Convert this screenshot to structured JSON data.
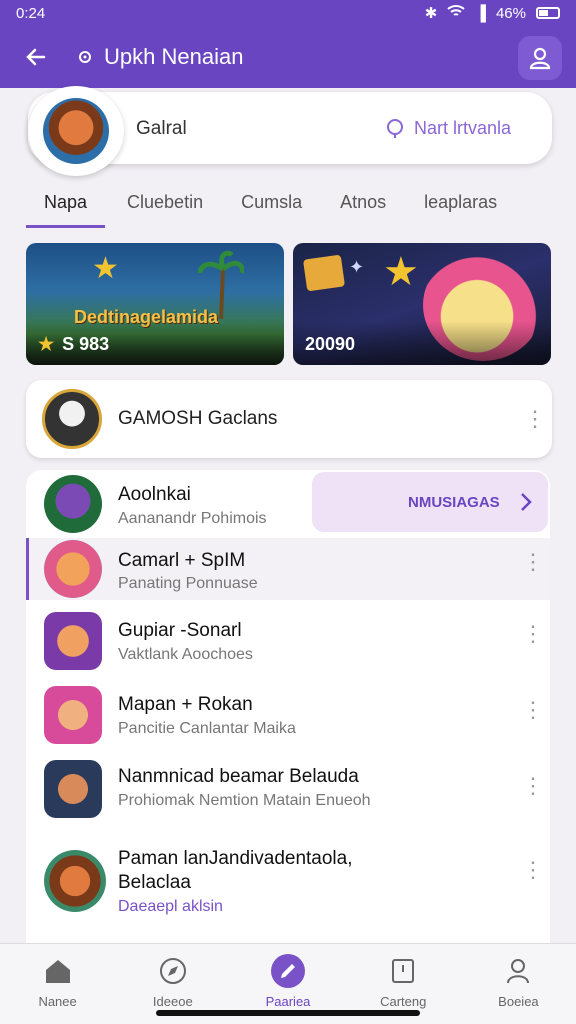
{
  "status_bar": {
    "time": "0:24",
    "battery": "46%"
  },
  "app_bar": {
    "title": "Upkh Nenaian"
  },
  "header_card": {
    "name": "Galral",
    "link_label": "Nart lrtvanla"
  },
  "tabs": [
    {
      "label": "Napa",
      "active": true
    },
    {
      "label": "Cluebetin",
      "active": false
    },
    {
      "label": "Cumsla",
      "active": false
    },
    {
      "label": "Atnos",
      "active": false
    },
    {
      "label": "leaplaras",
      "active": false
    }
  ],
  "banners": [
    {
      "title": "Dedtinagelamida",
      "price": "S 983"
    },
    {
      "title": "",
      "price": "20090"
    }
  ],
  "featured": {
    "name": "GAMOSH Gaclans"
  },
  "list": [
    {
      "name": "Aoolnkai",
      "sub": "Aananandr Pohimois",
      "cta": "NMUSIAGAS"
    },
    {
      "name": "Camarl + SpIM",
      "sub": "Panating Ponnuase",
      "selected": true
    },
    {
      "name": "Gupiar -Sonarl",
      "sub": "Vaktlank Aoochoes"
    },
    {
      "name": "Mapan + Rokan",
      "sub": "Pancitie Canlantar Maika"
    },
    {
      "name": "Nanmnicad beamar Belauda",
      "sub": "Prohiomak Nemtion Matain Enueoh"
    },
    {
      "name": "Paman lanJandivadentaola,",
      "name2": "Belaclaa",
      "sub": "Daeaepl aklsin"
    }
  ],
  "bottom_nav": [
    {
      "label": "Nanee",
      "icon": "home-icon"
    },
    {
      "label": "Ideeoe",
      "icon": "compass-icon"
    },
    {
      "label": "Paariea",
      "icon": "pen-icon",
      "active": true
    },
    {
      "label": "Carteng",
      "icon": "card-icon"
    },
    {
      "label": "Boeiea",
      "icon": "person-icon"
    }
  ],
  "colors": {
    "primary": "#6a45c2",
    "accent": "#7a52c8",
    "cta_bg": "#f0e2f6"
  }
}
